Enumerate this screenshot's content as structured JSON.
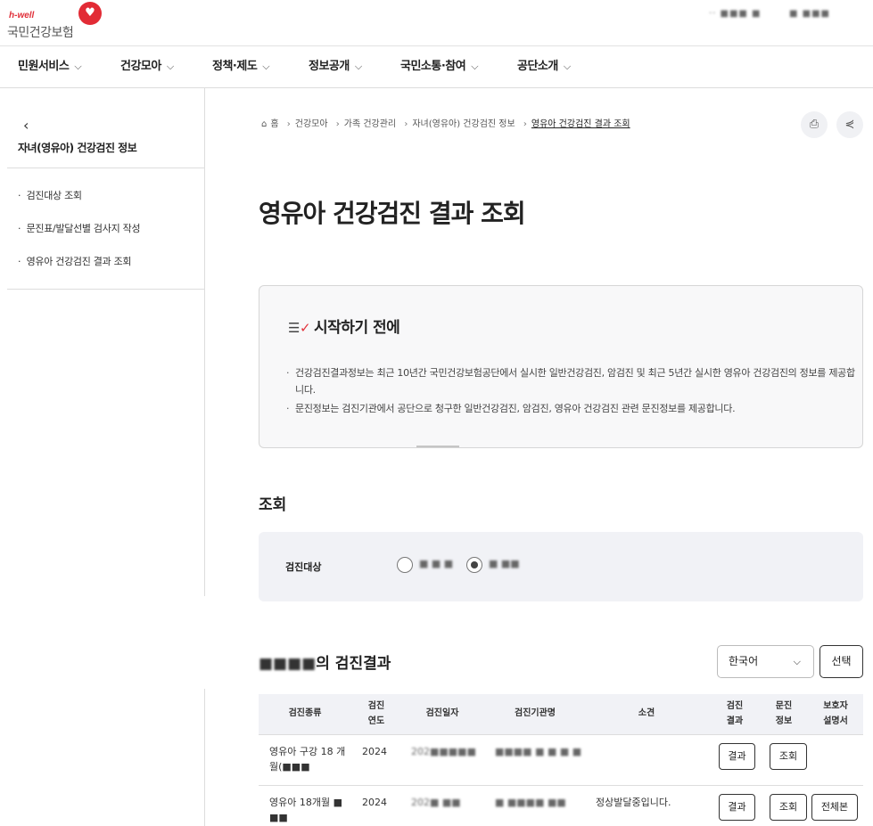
{
  "header": {
    "logo_sub": "h-well",
    "logo_name": "국민건강보험",
    "util_left": "·· ■■■ ■",
    "util_right": "■ ■■■"
  },
  "gnb": [
    "민원서비스",
    "건강모아",
    "정책·제도",
    "정보공개",
    "국민소통·참여",
    "공단소개"
  ],
  "sidebar": {
    "title": "자녀(영유아) 건강검진 정보",
    "items": [
      "검진대상 조회",
      "문진표/발달선별 검사지 작성",
      "영유아 건강검진 결과 조회"
    ]
  },
  "breadcrumb": {
    "home": "홈",
    "items": [
      "건강모아",
      "가족 건강관리",
      "자녀(영유아) 건강검진 정보"
    ],
    "current": "영유아 건강검진 결과 조회"
  },
  "page_title": "영유아 건강검진 결과 조회",
  "notice": {
    "title": "시작하기 전에",
    "items": [
      "건강검진결과정보는 최근 10년간 국민건강보험공단에서 실시한 일반건강검진, 암검진 및 최근 5년간 실시한 영유아 건강검진의 정보를 제공합니다.",
      "문진정보는 검진기관에서 공단으로 청구한 일반건강검진, 암검진, 영유아 건강검진 관련 문진정보를 제공합니다."
    ]
  },
  "query": {
    "heading": "조회",
    "label": "검진대상",
    "options": [
      "■ ■ ■",
      "■ ■■"
    ],
    "selected_index": 1
  },
  "results": {
    "title_blur": "■■■■",
    "title_suffix": "의 검진결과",
    "language": "한국어",
    "select_button": "선택",
    "columns": [
      "검진종류",
      "검진\n연도",
      "검진일자",
      "검진기관명",
      "소견",
      "검진\n결과",
      "문진\n정보",
      "보호자\n설명서"
    ],
    "rows": [
      {
        "type": "영유아 구강 18 개월(■■■",
        "year": "2024",
        "date": "202■■■■■",
        "org": "■■■■ ■ ■ ■ ■",
        "finding": "",
        "result_btn": "결과",
        "inquiry_btn": "조회",
        "guide_btn": ""
      },
      {
        "type": "영유아 18개월 ■ ■■",
        "year": "2024",
        "date": "202■ ■■",
        "org": "■ ■■■■ ■■",
        "finding": "정상발달중입니다.",
        "result_btn": "결과",
        "inquiry_btn": "조회",
        "guide_btn": "전체본"
      }
    ]
  }
}
